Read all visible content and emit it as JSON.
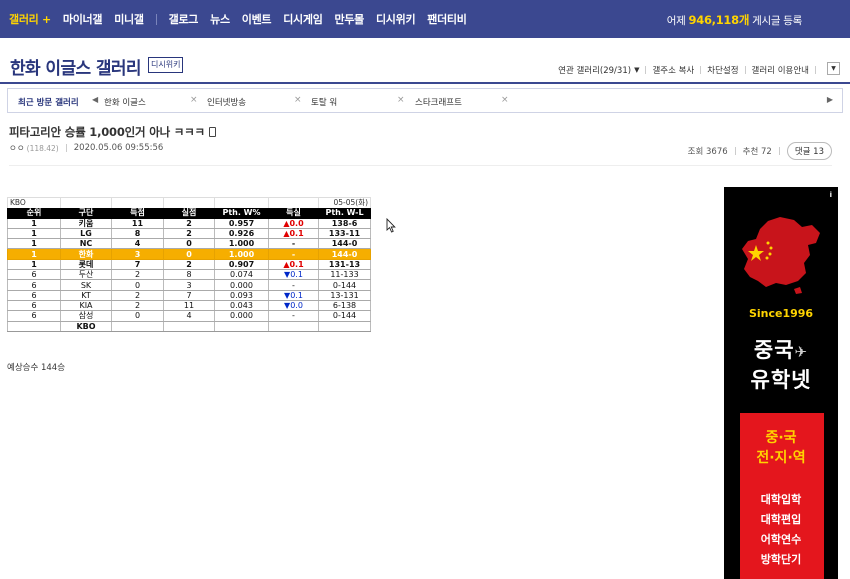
{
  "nav": {
    "items": [
      "갤러리 +",
      "마이너갤",
      "미니갤",
      "갤로그",
      "뉴스",
      "이벤트",
      "디시게임",
      "만두몰",
      "디시위키",
      "팬더티비"
    ],
    "visit_prefix": "어제",
    "visit_count": "946,118개",
    "visit_suffix": "게시글 등록"
  },
  "gallery": {
    "title": "한화 이글스 갤러리",
    "wiki_button": "디시위키",
    "links": [
      "연관 갤러리(29/31)",
      "갤주소 복사",
      "차단설정",
      "갤러리 이용안내"
    ]
  },
  "recent": {
    "label": "최근 방문 갤러리",
    "items": [
      "한화 이글스",
      "인터넷방송",
      "토탈 워",
      "스타크래프트"
    ]
  },
  "post": {
    "title": "피타고리안 승률 1,000인거 아나 ㅋㅋㅋ",
    "author": "ㅇㅇ",
    "ip": "(118.42)",
    "date": "2020.05.06 09:55:56",
    "views_label": "조회 3676",
    "recommend_label": "추천 72",
    "comments_label": "댓글 13"
  },
  "standings": {
    "league": "KBO",
    "date": "05-05(화)",
    "headers": [
      "순위",
      "구단",
      "득점",
      "실점",
      "Pth. W%",
      "득실",
      "Pth. W-L"
    ],
    "rows": [
      {
        "rank": "1",
        "team": "키움",
        "rs": "11",
        "ra": "2",
        "pct": "0.957",
        "diff_dir": "up",
        "diff": "0.0",
        "wl": "138-6",
        "style": "bold"
      },
      {
        "rank": "1",
        "team": "LG",
        "rs": "8",
        "ra": "2",
        "pct": "0.926",
        "diff_dir": "up",
        "diff": "0.1",
        "wl": "133-11",
        "style": "bold"
      },
      {
        "rank": "1",
        "team": "NC",
        "rs": "4",
        "ra": "0",
        "pct": "1.000",
        "diff_dir": "none",
        "diff": "-",
        "wl": "144-0",
        "style": "bold"
      },
      {
        "rank": "1",
        "team": "한화",
        "rs": "3",
        "ra": "0",
        "pct": "1.000",
        "diff_dir": "none",
        "diff": "-",
        "wl": "144-0",
        "style": "hl"
      },
      {
        "rank": "1",
        "team": "롯데",
        "rs": "7",
        "ra": "2",
        "pct": "0.907",
        "diff_dir": "up",
        "diff": "0.1",
        "wl": "131-13",
        "style": "bold"
      },
      {
        "rank": "6",
        "team": "두산",
        "rs": "2",
        "ra": "8",
        "pct": "0.074",
        "diff_dir": "down",
        "diff": "0.1",
        "wl": "11-133",
        "style": "normal"
      },
      {
        "rank": "6",
        "team": "SK",
        "rs": "0",
        "ra": "3",
        "pct": "0.000",
        "diff_dir": "none",
        "diff": "-",
        "wl": "0-144",
        "style": "normal"
      },
      {
        "rank": "6",
        "team": "KT",
        "rs": "2",
        "ra": "7",
        "pct": "0.093",
        "diff_dir": "down",
        "diff": "0.1",
        "wl": "13-131",
        "style": "normal"
      },
      {
        "rank": "6",
        "team": "KIA",
        "rs": "2",
        "ra": "11",
        "pct": "0.043",
        "diff_dir": "down",
        "diff": "0.0",
        "wl": "6-138",
        "style": "normal"
      },
      {
        "rank": "6",
        "team": "삼성",
        "rs": "0",
        "ra": "4",
        "pct": "0.000",
        "diff_dir": "none",
        "diff": "-",
        "wl": "0-144",
        "style": "normal"
      }
    ],
    "footer": "KBO",
    "note": "예상승수 144승"
  },
  "ad": {
    "info": "i",
    "since": "Since1996",
    "brand_line1": "중국",
    "brand_line2": "유학넷",
    "slogan_line1": "중·국",
    "slogan_line2": "전·지·역",
    "services": [
      "대학입학",
      "대학편입",
      "어학연수",
      "방학단기"
    ]
  },
  "colors": {
    "nav_bg": "#3b4890",
    "accent_yellow": "#ffd400",
    "highlight_row": "#f6ae00",
    "diff_up": "#e00000",
    "diff_down": "#0028c8",
    "ad_red": "#e4161d"
  }
}
